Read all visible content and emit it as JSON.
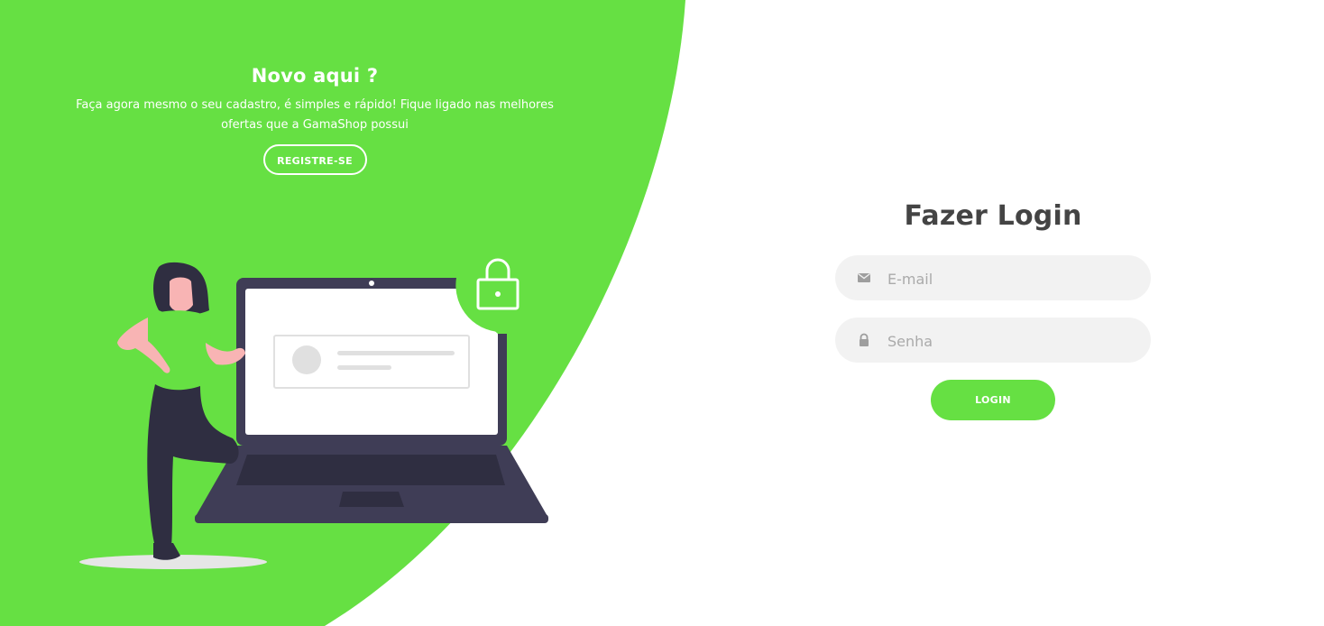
{
  "colors": {
    "brand_green": "#66e043",
    "dark_text": "#444444",
    "input_bg": "#f2f2f2",
    "laptop_dark": "#3f3d56",
    "figure_dark": "#2f2e41",
    "skin": "#f8b4b4"
  },
  "promo": {
    "title": "Novo aqui ?",
    "text": "Faça agora mesmo o seu cadastro, é simples e rápido! Fique ligado nas melhores ofertas que a GamaShop possui",
    "register_label": "REGISTRE-SE"
  },
  "illustration": {
    "lock_icon": "padlock-icon",
    "profile_card_icon": "avatar-placeholder-icon"
  },
  "login": {
    "title": "Fazer Login",
    "email_placeholder": "E-mail",
    "email_icon": "envelope-icon",
    "password_placeholder": "Senha",
    "password_icon": "lock-icon",
    "submit_label": "LOGIN"
  }
}
